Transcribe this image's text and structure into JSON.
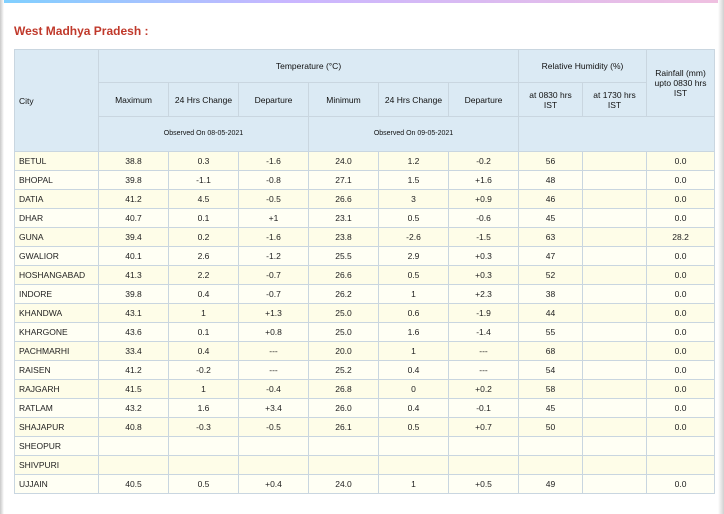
{
  "title": "West Madhya Pradesh :",
  "headers": {
    "city": "City",
    "temperature": "Temperature (°C)",
    "humidity": "Relative Humidity (%)",
    "rainfall": "Rainfall (mm) upto 0830 hrs IST",
    "maximum": "Maximum",
    "change_max": "24 Hrs Change",
    "departure_max": "Departure",
    "minimum": "Minimum",
    "change_min": "24 Hrs Change",
    "departure_min": "Departure",
    "rh_0830": "at 0830 hrs IST",
    "rh_1730": "at 1730 hrs IST",
    "observed_max": "Observed On 08-05-2021",
    "observed_min": "Observed On 09-05-2021"
  },
  "rows": [
    {
      "city": "BETUL",
      "max": "38.8",
      "max_chg": "0.3",
      "max_dep": "-1.6",
      "min": "24.0",
      "min_chg": "1.2",
      "min_dep": "-0.2",
      "rh1": "56",
      "rh2": "",
      "rain": "0.0"
    },
    {
      "city": "BHOPAL",
      "max": "39.8",
      "max_chg": "-1.1",
      "max_dep": "-0.8",
      "min": "27.1",
      "min_chg": "1.5",
      "min_dep": "+1.6",
      "rh1": "48",
      "rh2": "",
      "rain": "0.0"
    },
    {
      "city": "DATIA",
      "max": "41.2",
      "max_chg": "4.5",
      "max_dep": "-0.5",
      "min": "26.6",
      "min_chg": "3",
      "min_dep": "+0.9",
      "rh1": "46",
      "rh2": "",
      "rain": "0.0"
    },
    {
      "city": "DHAR",
      "max": "40.7",
      "max_chg": "0.1",
      "max_dep": "+1",
      "min": "23.1",
      "min_chg": "0.5",
      "min_dep": "-0.6",
      "rh1": "45",
      "rh2": "",
      "rain": "0.0"
    },
    {
      "city": "GUNA",
      "max": "39.4",
      "max_chg": "0.2",
      "max_dep": "-1.6",
      "min": "23.8",
      "min_chg": "-2.6",
      "min_dep": "-1.5",
      "rh1": "63",
      "rh2": "",
      "rain": "28.2"
    },
    {
      "city": "GWALIOR",
      "max": "40.1",
      "max_chg": "2.6",
      "max_dep": "-1.2",
      "min": "25.5",
      "min_chg": "2.9",
      "min_dep": "+0.3",
      "rh1": "47",
      "rh2": "",
      "rain": "0.0"
    },
    {
      "city": "HOSHANGABAD",
      "max": "41.3",
      "max_chg": "2.2",
      "max_dep": "-0.7",
      "min": "26.6",
      "min_chg": "0.5",
      "min_dep": "+0.3",
      "rh1": "52",
      "rh2": "",
      "rain": "0.0"
    },
    {
      "city": "INDORE",
      "max": "39.8",
      "max_chg": "0.4",
      "max_dep": "-0.7",
      "min": "26.2",
      "min_chg": "1",
      "min_dep": "+2.3",
      "rh1": "38",
      "rh2": "",
      "rain": "0.0"
    },
    {
      "city": "KHANDWA",
      "max": "43.1",
      "max_chg": "1",
      "max_dep": "+1.3",
      "min": "25.0",
      "min_chg": "0.6",
      "min_dep": "-1.9",
      "rh1": "44",
      "rh2": "",
      "rain": "0.0"
    },
    {
      "city": "KHARGONE",
      "max": "43.6",
      "max_chg": "0.1",
      "max_dep": "+0.8",
      "min": "25.0",
      "min_chg": "1.6",
      "min_dep": "-1.4",
      "rh1": "55",
      "rh2": "",
      "rain": "0.0"
    },
    {
      "city": "PACHMARHI",
      "max": "33.4",
      "max_chg": "0.4",
      "max_dep": "---",
      "min": "20.0",
      "min_chg": "1",
      "min_dep": "---",
      "rh1": "68",
      "rh2": "",
      "rain": "0.0"
    },
    {
      "city": "RAISEN",
      "max": "41.2",
      "max_chg": "-0.2",
      "max_dep": "---",
      "min": "25.2",
      "min_chg": "0.4",
      "min_dep": "---",
      "rh1": "54",
      "rh2": "",
      "rain": "0.0"
    },
    {
      "city": "RAJGARH",
      "max": "41.5",
      "max_chg": "1",
      "max_dep": "-0.4",
      "min": "26.8",
      "min_chg": "0",
      "min_dep": "+0.2",
      "rh1": "58",
      "rh2": "",
      "rain": "0.0"
    },
    {
      "city": "RATLAM",
      "max": "43.2",
      "max_chg": "1.6",
      "max_dep": "+3.4",
      "min": "26.0",
      "min_chg": "0.4",
      "min_dep": "-0.1",
      "rh1": "45",
      "rh2": "",
      "rain": "0.0"
    },
    {
      "city": "SHAJAPUR",
      "max": "40.8",
      "max_chg": "-0.3",
      "max_dep": "-0.5",
      "min": "26.1",
      "min_chg": "0.5",
      "min_dep": "+0.7",
      "rh1": "50",
      "rh2": "",
      "rain": "0.0"
    },
    {
      "city": "SHEOPUR",
      "max": "",
      "max_chg": "",
      "max_dep": "",
      "min": "",
      "min_chg": "",
      "min_dep": "",
      "rh1": "",
      "rh2": "",
      "rain": ""
    },
    {
      "city": "SHIVPURI",
      "max": "",
      "max_chg": "",
      "max_dep": "",
      "min": "",
      "min_chg": "",
      "min_dep": "",
      "rh1": "",
      "rh2": "",
      "rain": ""
    },
    {
      "city": "UJJAIN",
      "max": "40.5",
      "max_chg": "0.5",
      "max_dep": "+0.4",
      "min": "24.0",
      "min_chg": "1",
      "min_dep": "+0.5",
      "rh1": "49",
      "rh2": "",
      "rain": "0.0"
    }
  ]
}
